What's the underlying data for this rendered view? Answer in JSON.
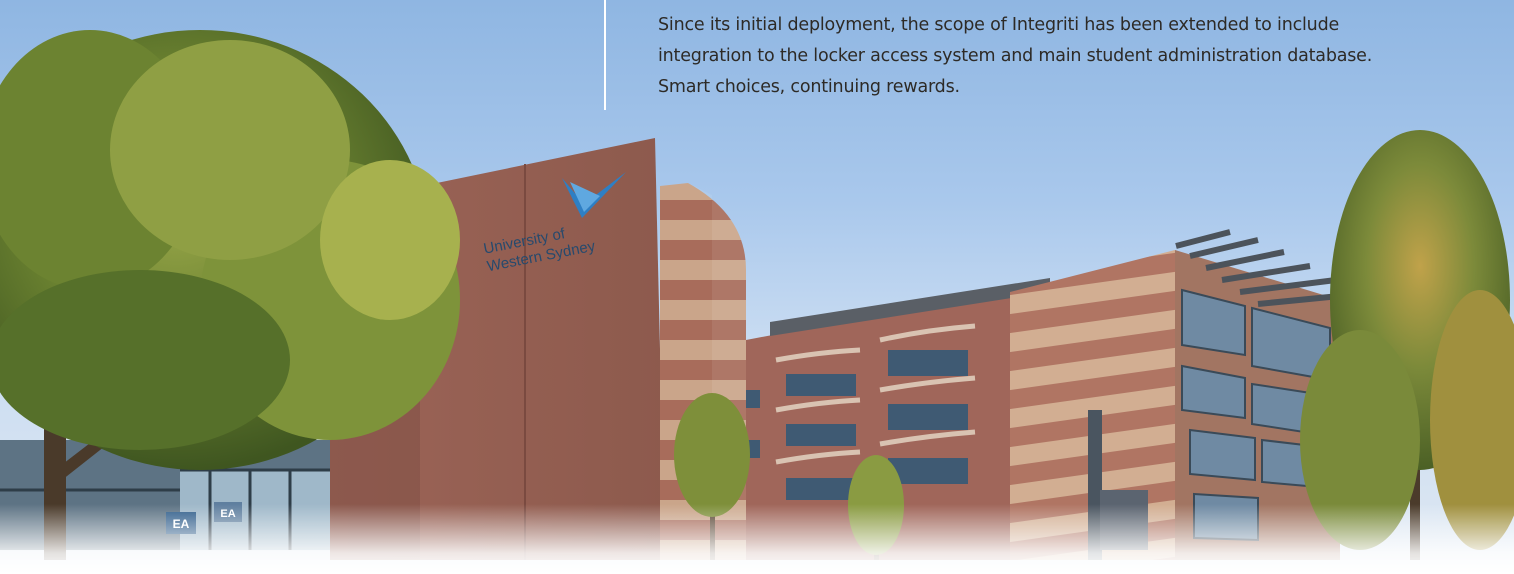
{
  "caption": {
    "lines": [
      "Since its initial deployment, the scope of Integriti has been extended to include",
      "integration to the locker access system and main student administration database.",
      "Smart choices, continuing rewards."
    ]
  },
  "building_sign": {
    "line1": "University of",
    "line2": "Western Sydney"
  },
  "entrance_signs": [
    "EA",
    "EA"
  ],
  "colors": {
    "sky_top": "#8fb6e2",
    "brick": "#a0665a",
    "brick_dark": "#8a5548",
    "stripe_light": "#c9a38a",
    "logo_blue": "#2e7fc4",
    "tree_green": "#5d7a2c",
    "caption_text": "#2d2a26"
  }
}
